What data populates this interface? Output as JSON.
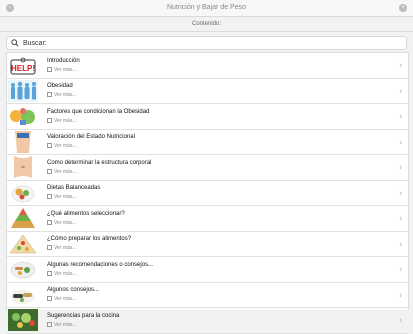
{
  "window": {
    "title": "Nutrición y Bajar de Peso"
  },
  "header": {
    "label": "Contenido:"
  },
  "search": {
    "placeholder": "Buscar:"
  },
  "items": [
    {
      "title": "Introducción",
      "more": "Ver más...",
      "icon": "help-sign-icon"
    },
    {
      "title": "Obesidad",
      "more": "Ver más...",
      "icon": "people-silhouette-icon"
    },
    {
      "title": "Factores que condicionan la Obesidad",
      "more": "Ver más...",
      "icon": "weight-factors-icon"
    },
    {
      "title": "Valoración del Estado Nutricional",
      "more": "Ver más...",
      "icon": "body-assessment-icon"
    },
    {
      "title": "Como determinar la estructura corporal",
      "more": "Ver más...",
      "icon": "waist-icon"
    },
    {
      "title": "Dietas Balanceadas",
      "more": "Ver más...",
      "icon": "balanced-plate-icon"
    },
    {
      "title": "¿Qué alimentos seleccionar?",
      "more": "Ver más...",
      "icon": "food-pyramid-icon"
    },
    {
      "title": "¿Cómo preparar los alimentos?",
      "more": "Ver más...",
      "icon": "food-preparation-icon"
    },
    {
      "title": "Algunas recomendaciones o consejos...",
      "more": "Ver más...",
      "icon": "plate-vegetables-icon"
    },
    {
      "title": "Algunos consejos...",
      "more": "Ver más...",
      "icon": "healthy-dish-icon"
    },
    {
      "title": "Sugerencias para la cocina",
      "more": "Ver más...",
      "icon": "kitchen-salad-icon"
    }
  ]
}
